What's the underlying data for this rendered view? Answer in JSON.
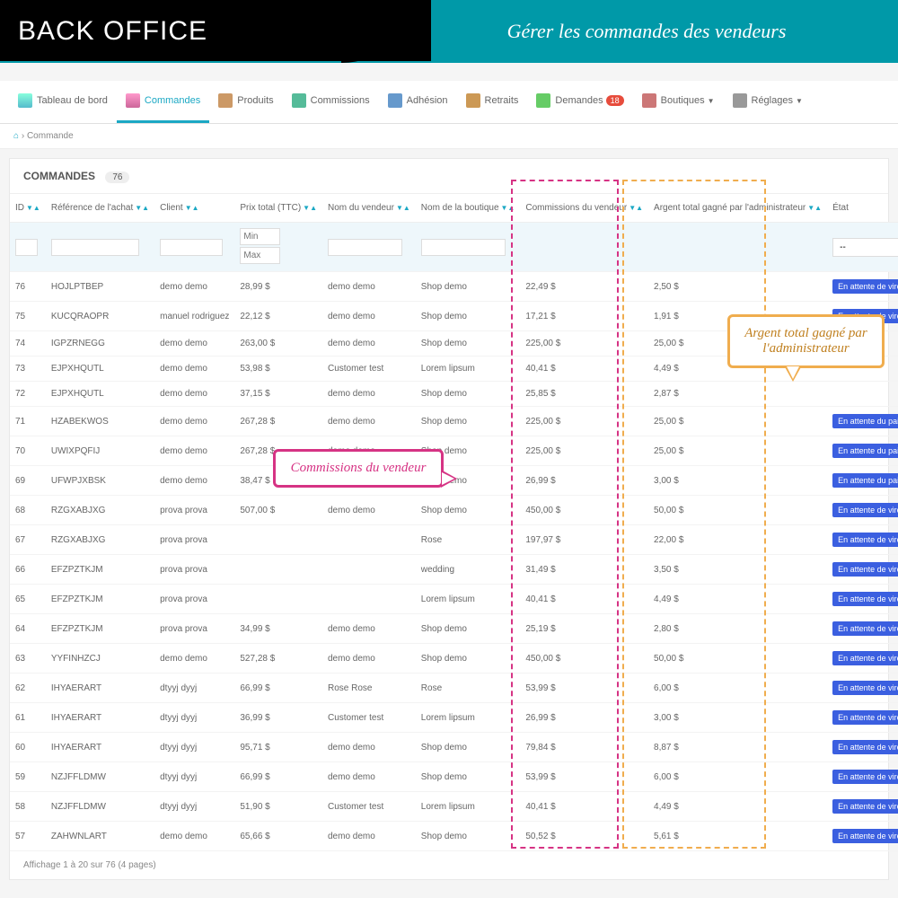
{
  "header": {
    "title": "BACK OFFICE",
    "subtitle": "Gérer les commandes des vendeurs"
  },
  "nav": {
    "items": [
      {
        "label": "Tableau de bord"
      },
      {
        "label": "Commandes"
      },
      {
        "label": "Produits"
      },
      {
        "label": "Commissions"
      },
      {
        "label": "Adhésion"
      },
      {
        "label": "Retraits"
      },
      {
        "label": "Demandes",
        "badge": "18"
      },
      {
        "label": "Boutiques"
      },
      {
        "label": "Réglages"
      }
    ]
  },
  "breadcrumb": {
    "sep": "›",
    "current": "Commande"
  },
  "panel": {
    "title": "COMMANDES",
    "count": "76"
  },
  "columns": {
    "id": "ID",
    "ref": "Référence de l'achat",
    "client": "Client",
    "prix": "Prix total (TTC)",
    "vendeur": "Nom du vendeur",
    "boutique": "Nom de la boutique",
    "comm": "Commissions du vendeur",
    "admin": "Argent total gagné par l'administrateur",
    "etat": "État"
  },
  "filters": {
    "min": "Min",
    "max": "Max",
    "dash": "--"
  },
  "rows": [
    {
      "id": "76",
      "ref": "HOJLPTBEP",
      "client": "demo demo",
      "prix": "28,99 $",
      "vendeur": "demo demo",
      "boutique": "Shop demo",
      "comm": "22,49 $",
      "admin": "2,50 $",
      "etat": "En attente de virement bancaire"
    },
    {
      "id": "75",
      "ref": "KUCQRAOPR",
      "client": "manuel rodriguez",
      "prix": "22,12 $",
      "vendeur": "demo demo",
      "boutique": "Shop demo",
      "comm": "17,21 $",
      "admin": "1,91 $",
      "etat": "En attente de virement bancaire"
    },
    {
      "id": "74",
      "ref": "IGPZRNEGG",
      "client": "demo demo",
      "prix": "263,00 $",
      "vendeur": "demo demo",
      "boutique": "Shop demo",
      "comm": "225,00 $",
      "admin": "25,00 $",
      "etat": ""
    },
    {
      "id": "73",
      "ref": "EJPXHQUTL",
      "client": "demo demo",
      "prix": "53,98 $",
      "vendeur": "Customer test",
      "boutique": "Lorem lipsum",
      "comm": "40,41 $",
      "admin": "4,49 $",
      "etat": ""
    },
    {
      "id": "72",
      "ref": "EJPXHQUTL",
      "client": "demo demo",
      "prix": "37,15 $",
      "vendeur": "demo demo",
      "boutique": "Shop demo",
      "comm": "25,85 $",
      "admin": "2,87 $",
      "etat": ""
    },
    {
      "id": "71",
      "ref": "HZABEKWOS",
      "client": "demo demo",
      "prix": "267,28 $",
      "vendeur": "demo demo",
      "boutique": "Shop demo",
      "comm": "225,00 $",
      "admin": "25,00 $",
      "etat": "En attente du paiement par chèque"
    },
    {
      "id": "70",
      "ref": "UWIXPQFIJ",
      "client": "demo demo",
      "prix": "267,28 $",
      "vendeur": "demo demo",
      "boutique": "Shop demo",
      "comm": "225,00 $",
      "admin": "25,00 $",
      "etat": "En attente du paiement par chèque"
    },
    {
      "id": "69",
      "ref": "UFWPJXBSK",
      "client": "demo demo",
      "prix": "38,47 $",
      "vendeur": "demo demo",
      "boutique": "Shop demo",
      "comm": "26,99 $",
      "admin": "3,00 $",
      "etat": "En attente du paiement par chèque"
    },
    {
      "id": "68",
      "ref": "RZGXABJXG",
      "client": "prova prova",
      "prix": "507,00 $",
      "vendeur": "demo demo",
      "boutique": "Shop demo",
      "comm": "450,00 $",
      "admin": "50,00 $",
      "etat": "En attente de virement bancaire"
    },
    {
      "id": "67",
      "ref": "RZGXABJXG",
      "client": "prova prova",
      "prix": "",
      "vendeur": "",
      "boutique": "Rose",
      "comm": "197,97 $",
      "admin": "22,00 $",
      "etat": "En attente de virement bancaire"
    },
    {
      "id": "66",
      "ref": "EFZPZTKJM",
      "client": "prova prova",
      "prix": "",
      "vendeur": "",
      "boutique": "wedding",
      "comm": "31,49 $",
      "admin": "3,50 $",
      "etat": "En attente de virement bancaire"
    },
    {
      "id": "65",
      "ref": "EFZPZTKJM",
      "client": "prova prova",
      "prix": "",
      "vendeur": "",
      "boutique": "Lorem lipsum",
      "comm": "40,41 $",
      "admin": "4,49 $",
      "etat": "En attente de virement bancaire"
    },
    {
      "id": "64",
      "ref": "EFZPZTKJM",
      "client": "prova prova",
      "prix": "34,99 $",
      "vendeur": "demo demo",
      "boutique": "Shop demo",
      "comm": "25,19 $",
      "admin": "2,80 $",
      "etat": "En attente de virement bancaire"
    },
    {
      "id": "63",
      "ref": "YYFINHZCJ",
      "client": "demo demo",
      "prix": "527,28 $",
      "vendeur": "demo demo",
      "boutique": "Shop demo",
      "comm": "450,00 $",
      "admin": "50,00 $",
      "etat": "En attente de virement bancaire"
    },
    {
      "id": "62",
      "ref": "IHYAERART",
      "client": "dtyyj dyyj",
      "prix": "66,99 $",
      "vendeur": "Rose Rose",
      "boutique": "Rose",
      "comm": "53,99 $",
      "admin": "6,00 $",
      "etat": "En attente de virement bancaire"
    },
    {
      "id": "61",
      "ref": "IHYAERART",
      "client": "dtyyj dyyj",
      "prix": "36,99 $",
      "vendeur": "Customer test",
      "boutique": "Lorem lipsum",
      "comm": "26,99 $",
      "admin": "3,00 $",
      "etat": "En attente de virement bancaire"
    },
    {
      "id": "60",
      "ref": "IHYAERART",
      "client": "dtyyj dyyj",
      "prix": "95,71 $",
      "vendeur": "demo demo",
      "boutique": "Shop demo",
      "comm": "79,84 $",
      "admin": "8,87 $",
      "etat": "En attente de virement bancaire"
    },
    {
      "id": "59",
      "ref": "NZJFFLDMW",
      "client": "dtyyj dyyj",
      "prix": "66,99 $",
      "vendeur": "demo demo",
      "boutique": "Shop demo",
      "comm": "53,99 $",
      "admin": "6,00 $",
      "etat": "En attente de virement bancaire"
    },
    {
      "id": "58",
      "ref": "NZJFFLDMW",
      "client": "dtyyj dyyj",
      "prix": "51,90 $",
      "vendeur": "Customer test",
      "boutique": "Lorem lipsum",
      "comm": "40,41 $",
      "admin": "4,49 $",
      "etat": "En attente de virement bancaire"
    },
    {
      "id": "57",
      "ref": "ZAHWNLART",
      "client": "demo demo",
      "prix": "65,66 $",
      "vendeur": "demo demo",
      "boutique": "Shop demo",
      "comm": "50,52 $",
      "admin": "5,61 $",
      "etat": "En attente de virement bancaire"
    }
  ],
  "pagination": "Affichage 1 à 20 sur 76 (4 pages)",
  "callouts": {
    "pink": "Commissions du vendeur",
    "orange": "Argent total gagné par l'administrateur"
  }
}
